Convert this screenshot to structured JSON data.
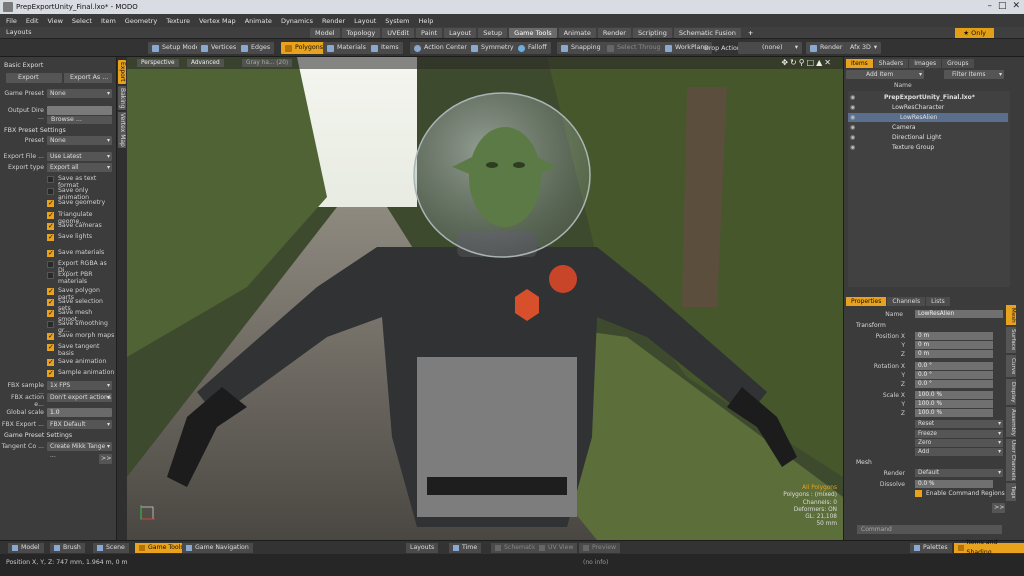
{
  "window": {
    "title": "PrepExportUnity_Final.lxo* - MODO"
  },
  "menu": [
    "File",
    "Edit",
    "View",
    "Select",
    "Item",
    "Geometry",
    "Texture",
    "Vertex Map",
    "Animate",
    "Dynamics",
    "Render",
    "Layout",
    "System",
    "Help"
  ],
  "layout_bar": {
    "label": "Layouts",
    "tabs": [
      "Model",
      "Topology",
      "UVEdit",
      "Paint",
      "Layout",
      "Setup",
      "Game Tools",
      "Animate",
      "Render",
      "Scripting",
      "Schematic Fusion"
    ],
    "active_tab": "Game Tools",
    "plus": "+",
    "only_label": "Only",
    "only_star": "★"
  },
  "toolbar": {
    "setup_mode": "Setup Mode",
    "vertices": "Vertices",
    "edges": "Edges",
    "polygons": "Polygons",
    "materials": "Materials",
    "items": "Items",
    "action_center": "Action Center",
    "symmetry": "Symmetry",
    "falloff": "Falloff",
    "snapping": "Snapping",
    "select_through": "Select Through",
    "workplane": "WorkPlane",
    "drop_action_label": "Drop Action",
    "drop_action_value": "(none)",
    "render": "Render",
    "afx": "Afx 3D"
  },
  "left_panel": {
    "vtabs": [
      "Export",
      "Baking",
      "Vertex Map"
    ],
    "basic_export": "Basic Export",
    "export_btn": "Export",
    "export_as_btn": "Export As ...",
    "game_preset_label": "Game Preset",
    "game_preset_value": "None",
    "output_dir_label": "Output Dire ...",
    "browse": "Browse ...",
    "fbx_preset_settings": "FBX Preset Settings",
    "preset_label": "Preset",
    "preset_value": "None",
    "export_file_label": "Export File ...",
    "export_file_value": "Use Latest",
    "export_type_label": "Export type",
    "export_type_value": "Export all",
    "checks": [
      {
        "label": "Save as text format",
        "on": false
      },
      {
        "label": "Save only animation",
        "on": false
      },
      {
        "label": "Save geometry",
        "on": true
      },
      {
        "label": "Triangulate geome...",
        "on": true
      },
      {
        "label": "Save cameras",
        "on": true
      },
      {
        "label": "Save lights",
        "on": true
      },
      {
        "label": "Save materials",
        "on": true
      },
      {
        "label": "Export RGBA as Di...",
        "on": false
      },
      {
        "label": "Export PBR materials",
        "on": false
      },
      {
        "label": "Save polygon parts",
        "on": true
      },
      {
        "label": "Save selection sets",
        "on": true
      },
      {
        "label": "Save mesh smoot...",
        "on": true
      },
      {
        "label": "Save smoothing gr...",
        "on": false
      },
      {
        "label": "Save morph maps",
        "on": true
      },
      {
        "label": "Save tangent basis",
        "on": true
      },
      {
        "label": "Save animation",
        "on": true
      },
      {
        "label": "Sample animation",
        "on": true
      }
    ],
    "fbx_sample_label": "FBX sample ...",
    "fbx_sample_value": "1x FPS",
    "fbx_action_label": "FBX action e...",
    "fbx_action_value": "Don't export actions",
    "global_scale_label": "Global scale",
    "global_scale_value": "1.0",
    "fbx_export_label": "FBX Export ...",
    "fbx_export_value": "FBX Default",
    "game_preset_settings": "Game Preset Settings",
    "tangent_label": "Tangent Co ...",
    "tangent_value": "Create Mikk Tange ...",
    "more_btn": ">>"
  },
  "viewport": {
    "tabs": [
      "Perspective",
      "Advanced",
      "Gray ha... (20)"
    ],
    "stats": {
      "all_polygons": "All Polygons",
      "polygons": "Polygons : (mixed)",
      "channels": "Channels: 0",
      "deformers": "Deformers: ON",
      "gl": "GL: 21,108",
      "scale": "50 mm"
    }
  },
  "items_panel": {
    "tabs": [
      "Items",
      "Shaders",
      "Images",
      "Groups"
    ],
    "add_item": "Add Item",
    "filter_items": "Filter Items",
    "name_col": "Name",
    "tree": [
      {
        "label": "PrepExportUnity_Final.lxo*",
        "indent": 0,
        "selected": false,
        "bold": true
      },
      {
        "label": "LowResCharacter",
        "indent": 1,
        "selected": false,
        "bold": false
      },
      {
        "label": "LowResAlien",
        "indent": 2,
        "selected": true,
        "bold": false
      },
      {
        "label": "Camera",
        "indent": 1,
        "selected": false,
        "bold": false
      },
      {
        "label": "Directional Light",
        "indent": 1,
        "selected": false,
        "bold": false
      },
      {
        "label": "Texture Group",
        "indent": 1,
        "selected": false,
        "bold": false
      }
    ]
  },
  "properties_panel": {
    "tabs": [
      "Properties",
      "Channels",
      "Lists"
    ],
    "name_label": "Name",
    "name_value": "LowResAlien",
    "transform": "Transform",
    "position_x_label": "Position X",
    "position": [
      "0 m",
      "0 m",
      "0 m"
    ],
    "rotation_x_label": "Rotation X",
    "rotation": [
      "0.0 °",
      "0.0 °",
      "0.0 °"
    ],
    "scale_x_label": "Scale X",
    "scale": [
      "100.0 %",
      "100.0 %",
      "100.0 %"
    ],
    "y_label": "Y",
    "z_label": "Z",
    "reset": "Reset",
    "freeze": "Freeze",
    "zero": "Zero",
    "add": "Add",
    "mesh": "Mesh",
    "render_label": "Render",
    "render_value": "Default",
    "dissolve_label": "Dissolve",
    "dissolve_value": "0.0 %",
    "enable_cmd": "Enable Command Regions",
    "more": ">>",
    "command_placeholder": "Command",
    "vtabs": [
      "Mesh",
      "Surface",
      "Curve",
      "Display",
      "Assembly",
      "User Channels",
      "Tags"
    ]
  },
  "bottom_bar": {
    "model": "Model",
    "brush": "Brush",
    "scene": "Scene",
    "game_tools": "Game Tools",
    "game_nav": "Game Navigation",
    "layouts": "Layouts",
    "time": "Time",
    "schematic": "Schematic",
    "uv_view": "UV View",
    "preview": "Preview",
    "palettes": "Palettes",
    "items_shading": "Items and Shading"
  },
  "status_bar": {
    "position": "Position X, Y, Z:  747 mm, 1.964 m, 0 m",
    "info": "(no info)"
  },
  "colors": {
    "accent": "#e9a21b",
    "panel": "#3c3c3c",
    "selection": "#5a6f8e"
  }
}
